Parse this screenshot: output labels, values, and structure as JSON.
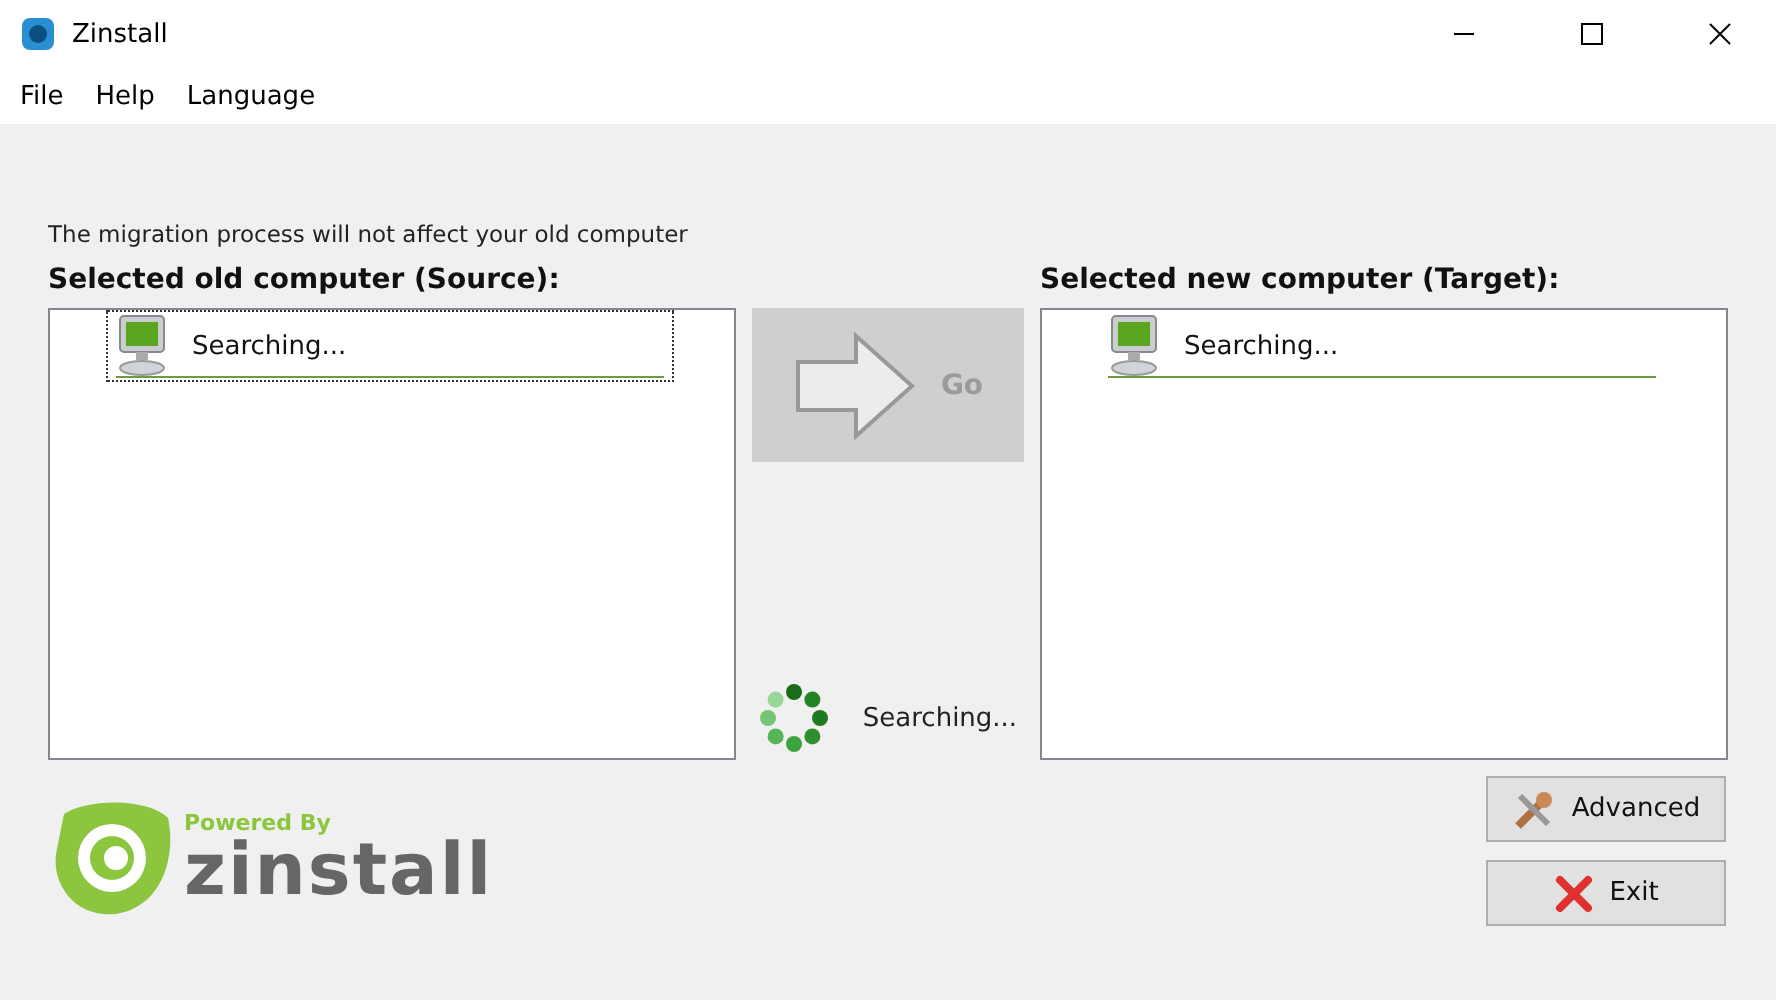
{
  "window": {
    "title": "Zinstall"
  },
  "menu": [
    "File",
    "Help",
    "Language"
  ],
  "notice": "The migration process will not affect your old computer",
  "source": {
    "heading": "Selected old computer (Source):",
    "items": [
      {
        "label": "Searching...",
        "selected": true
      }
    ]
  },
  "target": {
    "heading": "Selected new computer (Target):",
    "items": [
      {
        "label": "Searching...",
        "selected": false
      }
    ]
  },
  "go_button": {
    "label": "Go",
    "disabled": true
  },
  "status": "Searching...",
  "logo": {
    "tagline": "Powered By",
    "name": "zinstall"
  },
  "buttons": [
    {
      "kind": "advanced",
      "label": "Advanced"
    },
    {
      "kind": "exit",
      "label": "Exit"
    }
  ]
}
